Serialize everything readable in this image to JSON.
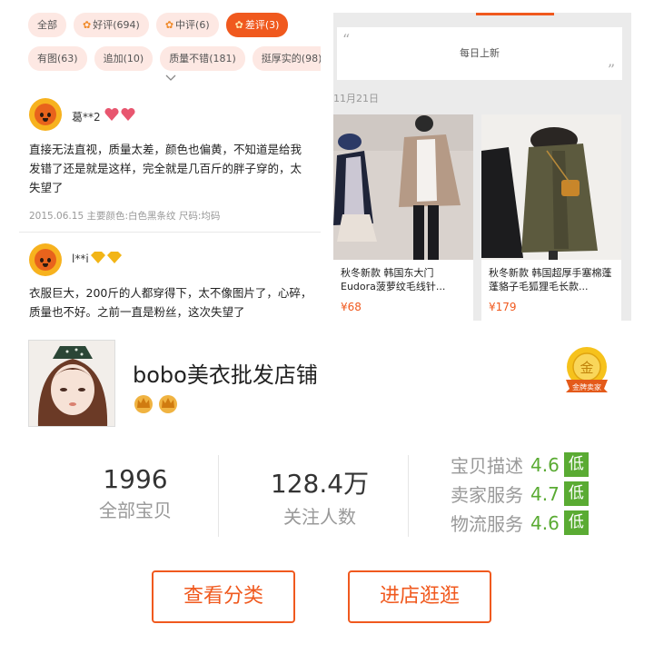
{
  "reviews_panel": {
    "filter_chips": [
      {
        "label": "全部",
        "count": "",
        "emoji": ""
      },
      {
        "label": "好评",
        "count": "(694)",
        "emoji": "✿"
      },
      {
        "label": "中评",
        "count": "(6)",
        "emoji": "✿"
      },
      {
        "label": "差评",
        "count": "(3)",
        "emoji": "✿"
      },
      {
        "label": "有图",
        "count": "(63)",
        "emoji": ""
      },
      {
        "label": "追加",
        "count": "(10)",
        "emoji": ""
      },
      {
        "label": "质量不错",
        "count": "(181)",
        "emoji": ""
      },
      {
        "label": "挺厚实的",
        "count": "(98)",
        "emoji": ""
      }
    ],
    "active_chip": "差评",
    "expand_icon": "chevron-down-icon",
    "reviews": [
      {
        "user": "葛**2",
        "level_badge": "heart",
        "text": "直接无法直视，质量太差，颜色也偏黄，不知道是给我发错了还是就是这样，完全就是几百斤的胖子穿的，太失望了",
        "meta": "2015.06.15 主要颜色:白色黑条纹  尺码:均码"
      },
      {
        "user": "l**i",
        "level_badge": "diamond",
        "text": "衣服巨大，200斤的人都穿得下，太不像图片了，心碎，质量也不好。之前一直是粉丝，这次失望了",
        "meta": ""
      }
    ]
  },
  "items_panel": {
    "notice": "每日上新",
    "date_label": "11月21日",
    "items": [
      {
        "title": "秋冬新款 韩国东大门Eudora菠萝纹毛线针...",
        "price": "¥68"
      },
      {
        "title": "秋冬新款 韩国超厚手塞棉蓬蓬貉子毛狐狸毛长款...",
        "price": "¥179"
      }
    ]
  },
  "shop_panel": {
    "name": "bobo美衣批发店铺",
    "crowns": 2,
    "gold_seller_text": "金",
    "gold_seller_ribbon": "金牌卖家",
    "stats": [
      {
        "value": "1996",
        "label": "全部宝贝"
      },
      {
        "value": "128.4万",
        "label": "关注人数"
      }
    ],
    "ratings": [
      {
        "label": "宝贝描述",
        "score": "4.6",
        "tag": "低"
      },
      {
        "label": "卖家服务",
        "score": "4.7",
        "tag": "低"
      },
      {
        "label": "物流服务",
        "score": "4.6",
        "tag": "低"
      }
    ],
    "buttons": {
      "category": "查看分类",
      "visit": "进店逛逛"
    }
  },
  "colors": {
    "accent": "#f0591e",
    "rating_green": "#5aab33",
    "chip_bg": "#fde8e3"
  }
}
